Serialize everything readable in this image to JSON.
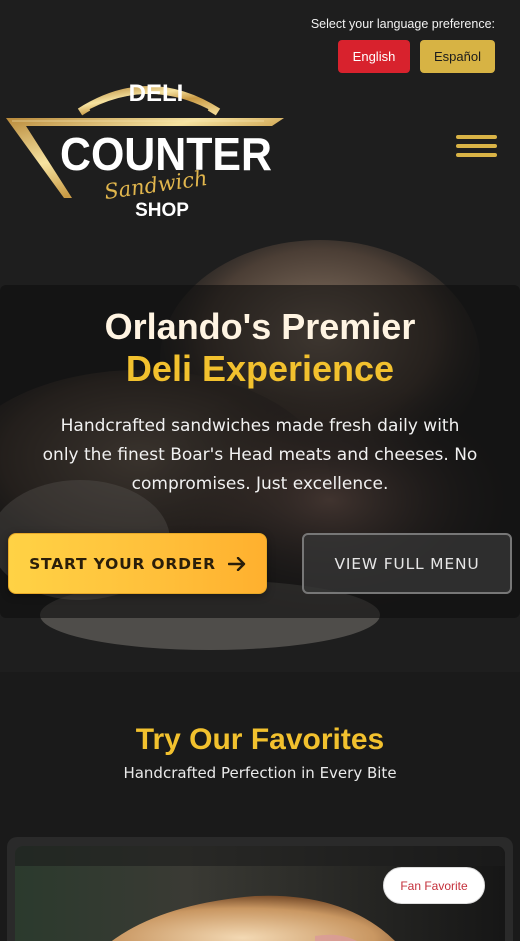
{
  "language": {
    "prompt": "Select your language preference:",
    "options": [
      {
        "label": "English",
        "selected": true,
        "color": "#d8222d"
      },
      {
        "label": "Español",
        "selected": false,
        "color": "#d7b344"
      }
    ]
  },
  "logo": {
    "line1": "DELI",
    "line2": "COUNTER",
    "line3": "Sandwich",
    "line4": "SHOP"
  },
  "nav": {
    "menu_icon": "hamburger-menu-icon",
    "menu_color": "#d9b346"
  },
  "hero": {
    "title_line1": "Orlando's Premier",
    "title_line2": "Deli Experience",
    "subtitle": "Handcrafted sandwiches made fresh daily with only the finest Boar's Head meats and cheeses. No compromises. Just excellence.",
    "primary_button": "START YOUR ORDER",
    "primary_icon": "arrow-right-icon",
    "secondary_button": "VIEW FULL MENU",
    "accent": "#f2c12e"
  },
  "favorites": {
    "title": "Try Our Favorites",
    "subtitle": "Handcrafted Perfection in Every Bite",
    "cards": [
      {
        "badge": "Fan Favorite"
      }
    ]
  }
}
